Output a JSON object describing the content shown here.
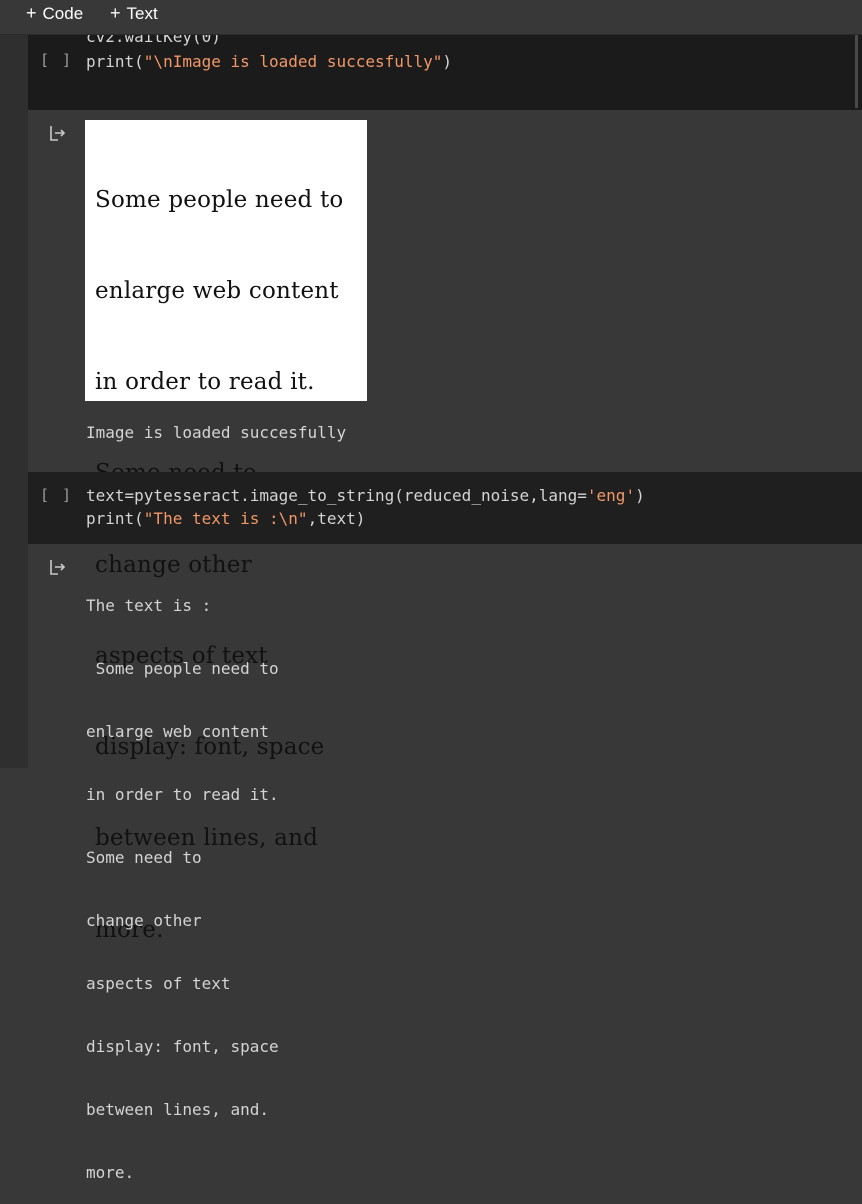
{
  "toolbar": {
    "add_code": "Code",
    "add_text": "Text"
  },
  "cell1": {
    "run_label": "[ ]",
    "line_cut": "cv2.waitKey(0)",
    "print_fn": "print(",
    "print_str": "\"\\nImage is loaded succesfully\"",
    "print_close": ")"
  },
  "output1": {
    "image_lines": [
      "Some people need to",
      "enlarge web content",
      "in order to read it.",
      "Some need to",
      "change other",
      "aspects of text",
      "display: font, space",
      "between lines, and",
      "more."
    ],
    "message": "Image is loaded succesfully"
  },
  "cell2": {
    "run_label": "[ ]",
    "l1_a": "text=pytesseract.image_to_string(reduced_noise,lang=",
    "l1_str": "'eng'",
    "l1_b": ")",
    "l2_a": "print(",
    "l2_str": "\"The text is :\\n\"",
    "l2_b": ",text)"
  },
  "output2": {
    "lines": [
      "The text is :",
      " Some people need to",
      "enlarge web content",
      "in order to read it.",
      "Some need to",
      "change other",
      "aspects of text",
      "display: font, space",
      "between lines, and.",
      "more."
    ]
  },
  "colors": {
    "background": "#383838",
    "cell_bg": "#1f1f1f",
    "string": "#f29766",
    "code_text": "#d4d4d4"
  },
  "icons": {
    "add": "plus-icon",
    "output": "output-redirect-icon"
  }
}
